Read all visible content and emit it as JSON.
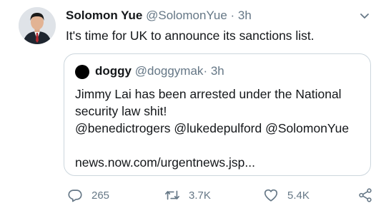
{
  "tweet": {
    "author": {
      "name": "Solomon Yue",
      "handle": "@SolomonYue"
    },
    "separator": "·",
    "time": "3h",
    "text": "It's time for UK to announce its sanctions list."
  },
  "quoted_tweet": {
    "author": {
      "name": "doggy",
      "handle": "@doggymak"
    },
    "separator": "·",
    "time": "3h",
    "lines": [
      "Jimmy Lai has been arrested under the National",
      "security law shit!",
      "@benedictrogers @lukedepulford @SolomonYue"
    ],
    "link": "news.now.com/urgentnews.jsp..."
  },
  "actions": {
    "reply_count": "265",
    "retweet_count": "3.7K",
    "like_count": "5.4K"
  },
  "icons": {
    "menu": "chevron-down-icon",
    "reply": "reply-icon",
    "retweet": "retweet-icon",
    "like": "heart-icon",
    "share": "share-icon"
  },
  "colors": {
    "text": "#14171a",
    "secondary": "#657786",
    "border": "#ccd6dd"
  }
}
